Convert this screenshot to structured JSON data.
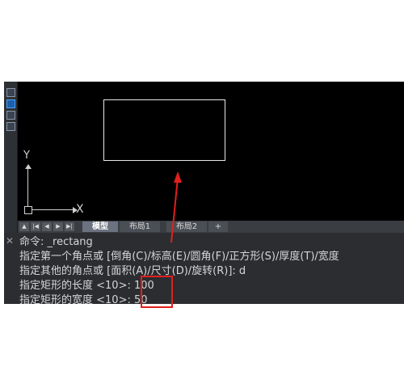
{
  "tabs": {
    "model": "模型",
    "layout1": "布局1",
    "layout2": "布局2",
    "add": "+"
  },
  "ucs": {
    "x_label": "X",
    "y_label": "Y"
  },
  "command_lines": [
    "命令: _rectang",
    "指定第一个角点或 [倒角(C)/标高(E)/圆角(F)/正方形(S)/厚度(T)/宽度",
    "指定其他的角点或 [面积(A)/尺寸(D)/旋转(R)]: d",
    "指定矩形的长度 <10>: 100",
    "指定矩形的宽度 <10>: 50"
  ],
  "colors": {
    "highlight": "#e0201c",
    "canvas": "#000000",
    "panel": "#2b2d31"
  }
}
